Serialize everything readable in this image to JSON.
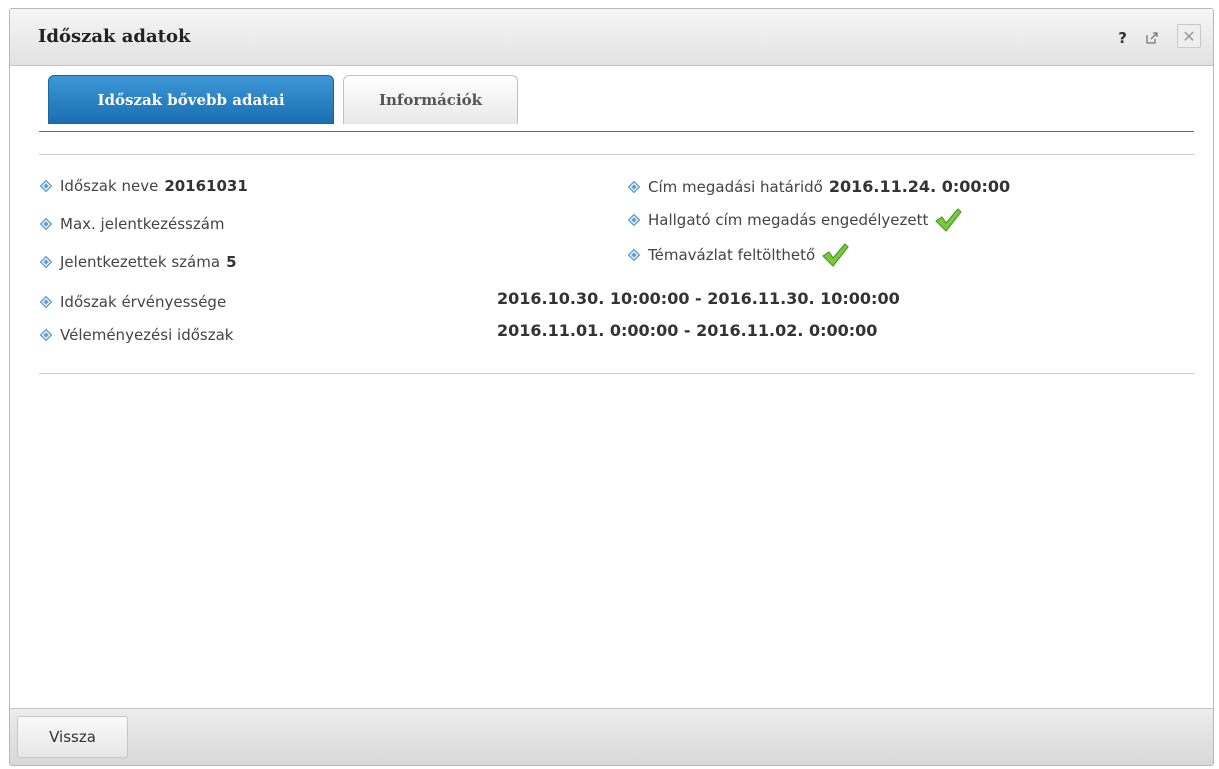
{
  "dialog": {
    "title": "Időszak adatok",
    "help_label": "?"
  },
  "tabs": [
    {
      "label": "Időszak bővebb adatai",
      "active": true
    },
    {
      "label": "Információk",
      "active": false
    }
  ],
  "left_fields": [
    {
      "label": "Időszak neve",
      "value": "20161031"
    },
    {
      "label": "Max. jelentkezésszám",
      "value": ""
    },
    {
      "label": "Jelentkezettek száma",
      "value": "5"
    }
  ],
  "right_fields": [
    {
      "label": "Cím megadási határidő",
      "value": "2016.11.24. 0:00:00"
    },
    {
      "label": "Hallgató cím megadás engedélyezett",
      "checked": true
    },
    {
      "label": "Témavázlat feltölthető",
      "checked": true
    }
  ],
  "periods": [
    {
      "label": "Időszak érvényessége",
      "value": "2016.10.30. 10:00:00 - 2016.11.30. 10:00:00"
    },
    {
      "label": "Véleményezési időszak",
      "value": "2016.11.01. 0:00:00 - 2016.11.02. 0:00:00"
    }
  ],
  "footer": {
    "back_label": "Vissza"
  },
  "colors": {
    "accent": "#1a6fb2",
    "bullet": "#5b9fd0",
    "check": "#6cc334"
  },
  "icons": {
    "help": "help-icon",
    "popout": "popout-icon",
    "close": "close-icon",
    "bullet": "diamond-bullet-icon",
    "check": "checkmark-icon"
  }
}
